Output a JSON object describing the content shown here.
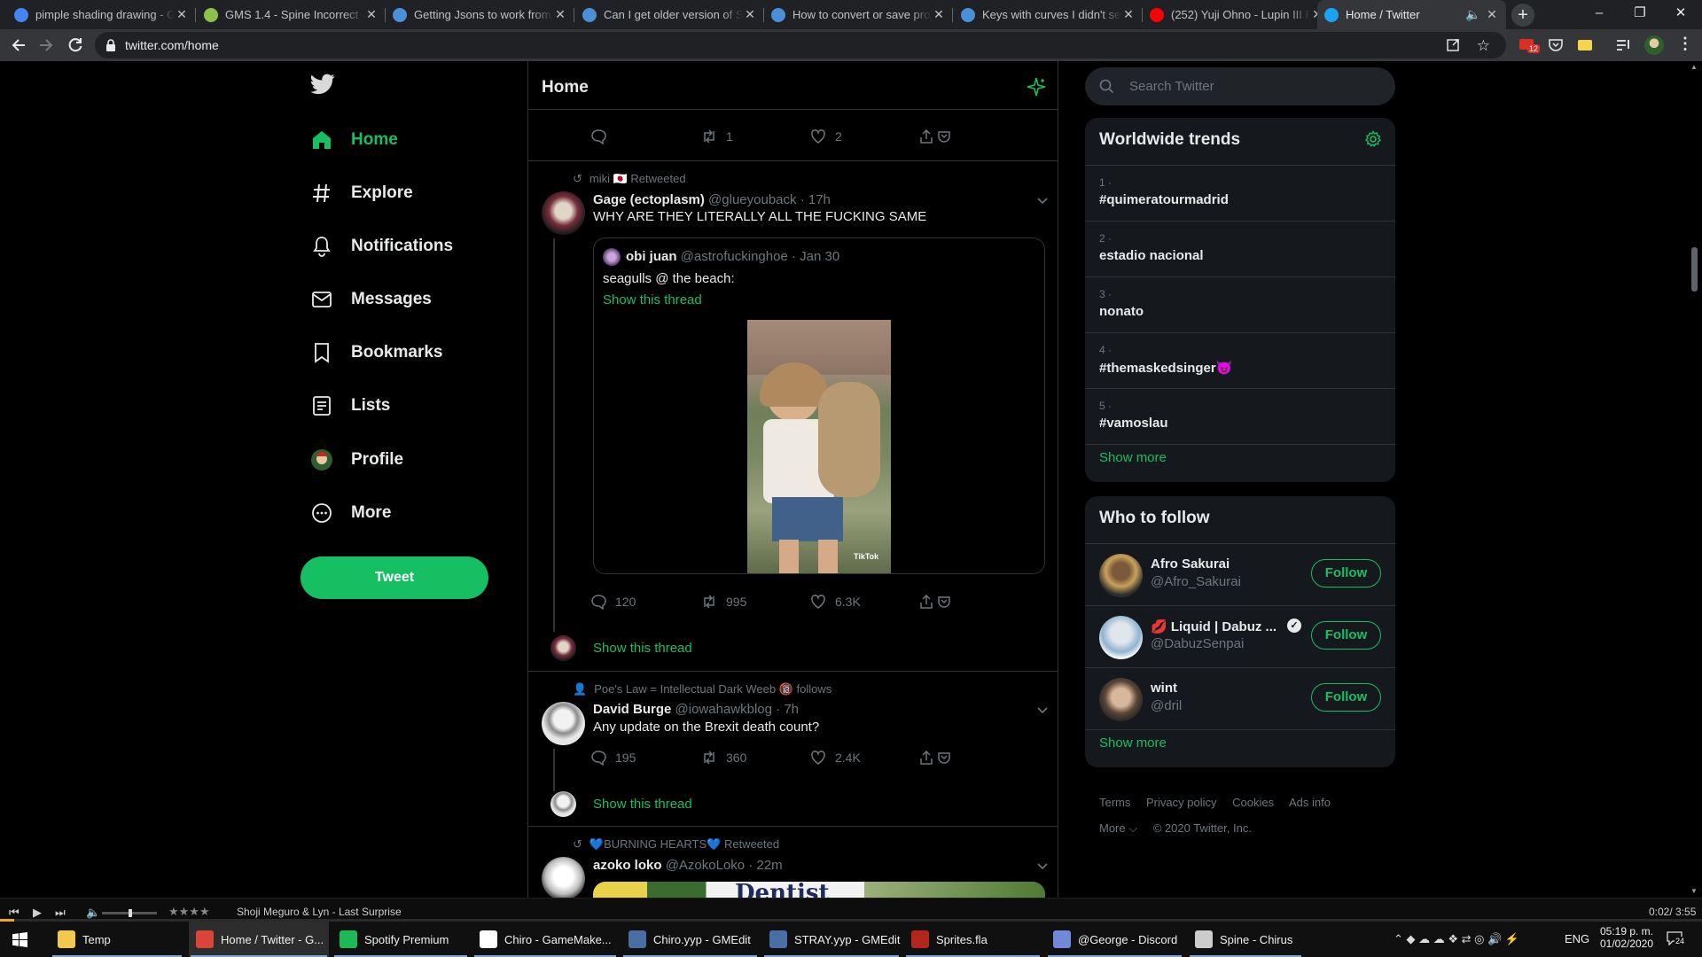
{
  "browser": {
    "tabs": [
      {
        "title": "pimple shading drawing - G",
        "favicon": "google",
        "color": "#4285f4"
      },
      {
        "title": "GMS 1.4 - Spine Incorrect",
        "favicon": "gamemaker",
        "color": "#8bc34a"
      },
      {
        "title": "Getting Jsons to work from",
        "favicon": "globe",
        "color": "#4a90d9"
      },
      {
        "title": "Can I get older version of S",
        "favicon": "globe",
        "color": "#4a90d9"
      },
      {
        "title": "How to convert or save proj",
        "favicon": "globe",
        "color": "#4a90d9"
      },
      {
        "title": "Keys with curves I didn't set",
        "favicon": "globe",
        "color": "#4a90d9"
      },
      {
        "title": "(252) Yuji Ohno - Lupin III F",
        "favicon": "youtube",
        "color": "#ff0000"
      },
      {
        "title": "Home / Twitter",
        "favicon": "twitter",
        "color": "#1da1f2",
        "active": true
      }
    ],
    "url": "twitter.com/home",
    "extension_badge": "12"
  },
  "twitter": {
    "nav": [
      {
        "label": "Home",
        "icon": "home-icon"
      },
      {
        "label": "Explore",
        "icon": "hash-icon"
      },
      {
        "label": "Notifications",
        "icon": "bell-icon"
      },
      {
        "label": "Messages",
        "icon": "mail-icon"
      },
      {
        "label": "Bookmarks",
        "icon": "bookmark-icon"
      },
      {
        "label": "Lists",
        "icon": "list-icon"
      },
      {
        "label": "Profile",
        "icon": "avatar-icon"
      },
      {
        "label": "More",
        "icon": "more-icon"
      }
    ],
    "tweet_button": "Tweet",
    "header_title": "Home",
    "top_actions": {
      "retweets": "1",
      "likes": "2"
    },
    "tweet1": {
      "context": "miki 🇯🇵 Retweeted",
      "name": "Gage (ectoplasm)",
      "handle": "@glueyouback",
      "time": "· 17h",
      "text": "WHY ARE THEY LITERALLY ALL THE FUCKING SAME",
      "quote": {
        "name": "obi juan",
        "handle": "@astrofuckinghoe",
        "time": "· Jan 30",
        "text": "seagulls @ the beach:",
        "show_thread": "Show this thread",
        "video_watermark": "TikTok"
      },
      "replies": "120",
      "retweets": "995",
      "likes": "6.3K",
      "show_thread": "Show this thread"
    },
    "tweet2": {
      "context": "Poe's Law = Intellectual Dark Weeb 🔞 follows",
      "name": "David Burge",
      "handle": "@iowahawkblog",
      "time": "· 7h",
      "text": "Any update on the Brexit death count?",
      "replies": "195",
      "retweets": "360",
      "likes": "2.4K",
      "show_thread": "Show this thread"
    },
    "tweet3": {
      "context": "💙BURNING HEARTS💙 Retweeted",
      "name": "azoko loko",
      "handle": "@AzokoLoko",
      "time": "· 22m",
      "image_text": "Dentist"
    },
    "search_placeholder": "Search Twitter",
    "trends": {
      "title": "Worldwide trends",
      "items": [
        {
          "rank": "1 ·",
          "name": "#quimeratourmadrid"
        },
        {
          "rank": "2 ·",
          "name": "estadio nacional"
        },
        {
          "rank": "3 ·",
          "name": "nonato"
        },
        {
          "rank": "4 ·",
          "name": "#themaskedsinger😈"
        },
        {
          "rank": "5 ·",
          "name": "#vamoslau"
        }
      ],
      "show_more": "Show more"
    },
    "who_to_follow": {
      "title": "Who to follow",
      "items": [
        {
          "name": "Afro Sakurai",
          "handle": "@Afro_Sakurai",
          "button": "Follow"
        },
        {
          "name": "💋 Liquid | Dabuz ...",
          "handle": "@DabuzSenpai",
          "button": "Follow"
        },
        {
          "name": "wint",
          "handle": "@dril",
          "button": "Follow"
        }
      ],
      "show_more": "Show more"
    },
    "footer": {
      "links": [
        "Terms",
        "Privacy policy",
        "Cookies",
        "Ads info"
      ],
      "more": "More ⌵",
      "copyright": "© 2020 Twitter, Inc."
    }
  },
  "media_player": {
    "rating": "★★★★",
    "track": "Shoji Meguro & Lyn - Last Surprise",
    "time": "0:02/ 3:55"
  },
  "taskbar": {
    "items": [
      {
        "label": "Temp",
        "color": "#f2c94c"
      },
      {
        "label": "Home / Twitter - G...",
        "color": "#db4437",
        "active": true
      },
      {
        "label": "Spotify Premium",
        "color": "#1db954"
      },
      {
        "label": "Chiro - GameMake...",
        "color": "#ffffff"
      },
      {
        "label": "Chiro.yyp - GMEdit",
        "color": "#4a6fa5"
      },
      {
        "label": "STRAY.yyp - GMEdit",
        "color": "#4a6fa5"
      },
      {
        "label": "Sprites.fla",
        "color": "#b3261e"
      },
      {
        "label": "@George - Discord",
        "color": "#7289da"
      },
      {
        "label": "Spine - Chirus",
        "color": "#cccccc"
      }
    ],
    "language": "ENG",
    "time": "05:19 p. m.",
    "date": "01/02/2020",
    "notifications": "24"
  }
}
